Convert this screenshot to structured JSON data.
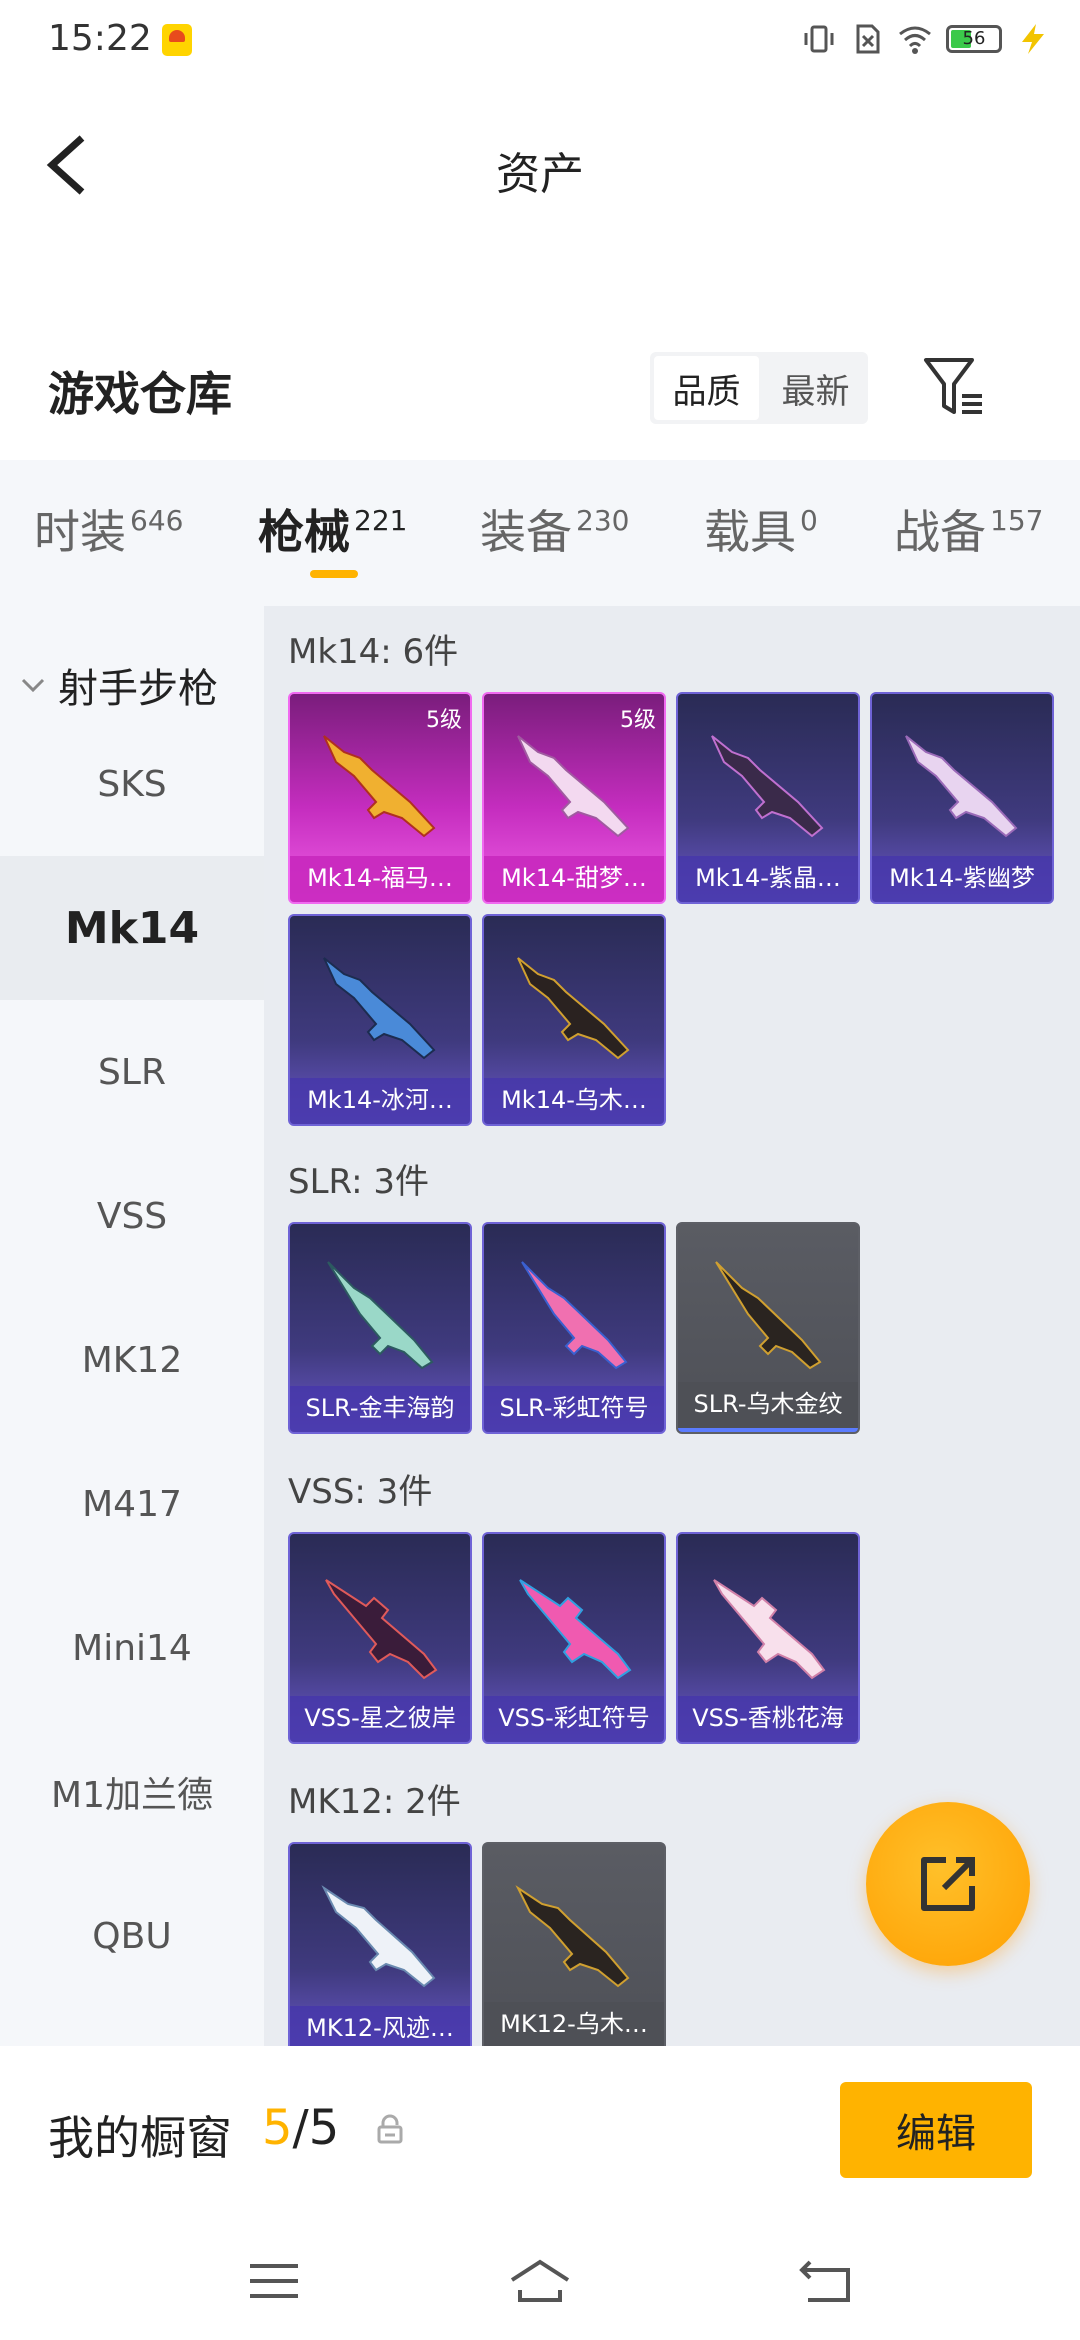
{
  "status_bar": {
    "time": "15:22",
    "battery": "56"
  },
  "header": {
    "title": "资产"
  },
  "warehouse": {
    "title": "游戏仓库",
    "sort_options": [
      "品质",
      "最新"
    ],
    "active_sort": "品质"
  },
  "tabs": [
    {
      "label": "时装",
      "count": "646"
    },
    {
      "label": "枪械",
      "count": "221"
    },
    {
      "label": "装备",
      "count": "230"
    },
    {
      "label": "载具",
      "count": "0"
    },
    {
      "label": "战备",
      "count": "157"
    }
  ],
  "active_tab": "枪械",
  "sidebar": {
    "group": "射手步枪",
    "items": [
      "SKS",
      "Mk14",
      "SLR",
      "VSS",
      "MK12",
      "M417",
      "Mini14",
      "M1加兰德",
      "QBU"
    ],
    "active": "Mk14"
  },
  "sections": [
    {
      "title": "Mk14: 6件",
      "items": [
        {
          "label": "Mk14-福马…",
          "level": "5级",
          "style": "pink"
        },
        {
          "label": "Mk14-甜梦…",
          "level": "5级",
          "style": "pink"
        },
        {
          "label": "Mk14-紫晶…",
          "style": "purple"
        },
        {
          "label": "Mk14-紫幽梦",
          "style": "purple"
        },
        {
          "label": "Mk14-冰河…",
          "style": "purple"
        },
        {
          "label": "Mk14-乌木…",
          "style": "purple"
        }
      ]
    },
    {
      "title": "SLR: 3件",
      "items": [
        {
          "label": "SLR-金丰海韵",
          "style": "purple"
        },
        {
          "label": "SLR-彩虹符号",
          "style": "purple"
        },
        {
          "label": "SLR-乌木金纹",
          "style": "gray"
        }
      ]
    },
    {
      "title": "VSS: 3件",
      "items": [
        {
          "label": "VSS-星之彼岸",
          "style": "purple"
        },
        {
          "label": "VSS-彩虹符号",
          "style": "purple"
        },
        {
          "label": "VSS-香桃花海",
          "style": "purple"
        }
      ]
    },
    {
      "title": "MK12: 2件",
      "items": [
        {
          "label": "MK12-风迹…",
          "style": "purple"
        },
        {
          "label": "MK12-乌木…",
          "style": "gray"
        }
      ]
    }
  ],
  "showcase": {
    "label": "我的橱窗",
    "current": "5",
    "total": "/5"
  },
  "edit_button": "编辑",
  "colors": {
    "accent": "#ffb300",
    "card_purple": "#3f3a7e",
    "card_pink": "#c52dbf",
    "card_gray": "#55575e"
  },
  "icons": [
    "back-icon",
    "filter-icon",
    "share-icon",
    "lock-icon",
    "menu-icon",
    "home-icon",
    "return-icon"
  ]
}
